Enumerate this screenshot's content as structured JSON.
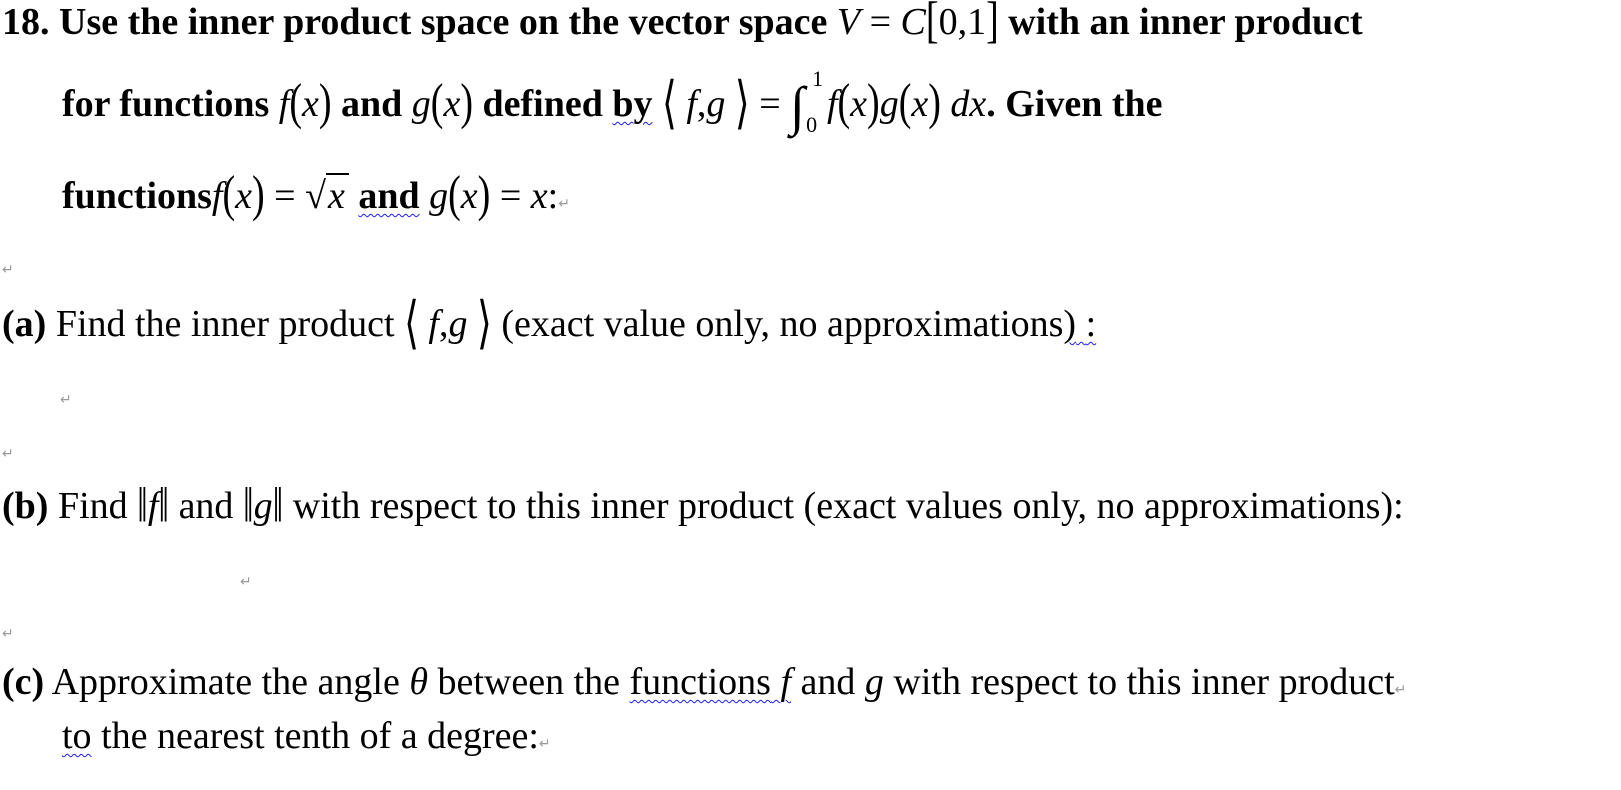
{
  "problem": {
    "number": "18.",
    "intro_line1": {
      "text_a": "Use the inner product space on the vector space",
      "V": "V",
      "eq": "=",
      "C": "C",
      "interval_open": "[",
      "interval_a": "0",
      "comma": ",",
      "interval_b": "1",
      "interval_close": "]",
      "text_b": "with an inner product"
    },
    "intro_line2": {
      "text_a": "for functions",
      "f": "f",
      "x": "x",
      "and": "and",
      "g": "g",
      "defined": "defined",
      "by": "by",
      "lang": "⟨",
      "rang": "⟩",
      "eq": "=",
      "integral": "∫",
      "upper": "1",
      "lower": "0",
      "dx": "dx",
      "period": ".",
      "text_b": "Given the"
    },
    "intro_line3": {
      "text_a": "functions",
      "f": "f",
      "x": "x",
      "eq": "=",
      "sqrt": "√",
      "and": "and",
      "g": "g",
      "colon": ":"
    },
    "paragraph_mark": "↵"
  },
  "parts": [
    {
      "label": "(a)",
      "text_a": "Find the inner product",
      "lang": "⟨",
      "f": "f",
      "comma": ",",
      "g": "g",
      "rang": "⟩",
      "text_b": "(exact value only, no approximations",
      "close_paren": ")",
      "colon": ":"
    },
    {
      "label": "(b)",
      "text_a": "Find",
      "norm": "‖",
      "f": "f",
      "and": "and",
      "g": "g",
      "text_b": "with respect to this inner product (exact values only, no approximations):"
    },
    {
      "label": "(c)",
      "text_a": "Approximate the angle",
      "theta": "θ",
      "text_b": "between the",
      "functions": "functions",
      "f": "f",
      "text_c": "and",
      "g": "g",
      "text_d": "with respect to this inner product",
      "line2_to": "to",
      "line2_rest": "the nearest tenth of a degree:"
    }
  ]
}
